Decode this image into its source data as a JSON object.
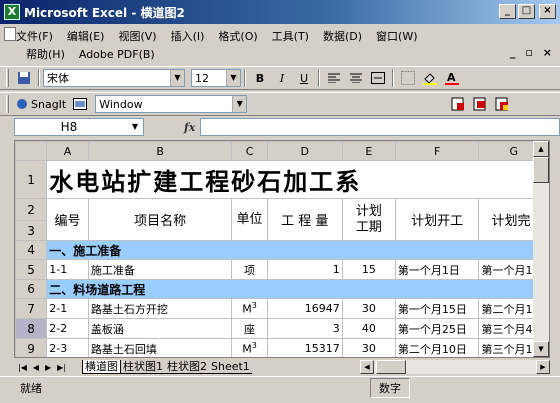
{
  "window": {
    "title": "Microsoft Excel - 横道图2",
    "icon": "excel-icon"
  },
  "menu": {
    "row1": [
      "文件(F)",
      "编辑(E)",
      "视图(V)",
      "插入(I)",
      "格式(O)",
      "工具(T)",
      "数据(D)",
      "窗口(W)"
    ],
    "row2": [
      "帮助(H)",
      "Adobe PDF(B)"
    ]
  },
  "toolbar": {
    "font_name": "宋体",
    "font_size": "12",
    "bold": "B",
    "italic": "I",
    "underline": "U"
  },
  "snagit": {
    "label": "SnagIt",
    "window_combo": "Window"
  },
  "formula": {
    "name_box": "H8",
    "fx": "fx"
  },
  "grid": {
    "columns": [
      "A",
      "B",
      "C",
      "D",
      "E",
      "F",
      "G"
    ],
    "title": "水电站扩建工程砂石加工系",
    "header": {
      "no": "编号",
      "name": "项目名称",
      "unit": "单位",
      "qty": "工 程 量",
      "period": "计划工期",
      "start": "计划开工",
      "end": "计划完"
    },
    "rows": [
      {
        "row": "4",
        "type": "section",
        "text": "一、施工准备"
      },
      {
        "row": "5",
        "type": "item",
        "no": "1-1",
        "name": "施工准备",
        "unit": "项",
        "unit_sup": "",
        "qty": "1",
        "period": "15",
        "start": "第一个月1日",
        "end": "第一个月1"
      },
      {
        "row": "6",
        "type": "section",
        "text": "二、料场道路工程"
      },
      {
        "row": "7",
        "type": "item",
        "no": "2-1",
        "name": "路基土石方开挖",
        "unit": "M",
        "unit_sup": "3",
        "qty": "16947",
        "period": "30",
        "start": "第一个月15日",
        "end": "第二个月1"
      },
      {
        "row": "8",
        "type": "item",
        "no": "2-2",
        "name": "盖板涵",
        "unit": "座",
        "unit_sup": "",
        "qty": "3",
        "period": "40",
        "start": "第一个月25日",
        "end": "第三个月4"
      },
      {
        "row": "9",
        "type": "item",
        "no": "2-3",
        "name": "路基土石回填",
        "unit": "M",
        "unit_sup": "3",
        "qty": "15317",
        "period": "30",
        "start": "第二个月10日",
        "end": "第三个月1"
      }
    ],
    "row_labels": {
      "r1": "1",
      "r2": "2",
      "r3": "3"
    }
  },
  "sheets": [
    "横道图",
    "柱状图1",
    "柱状图2",
    "Sheet1"
  ],
  "status": {
    "ready": "就绪",
    "mode": "数字"
  }
}
